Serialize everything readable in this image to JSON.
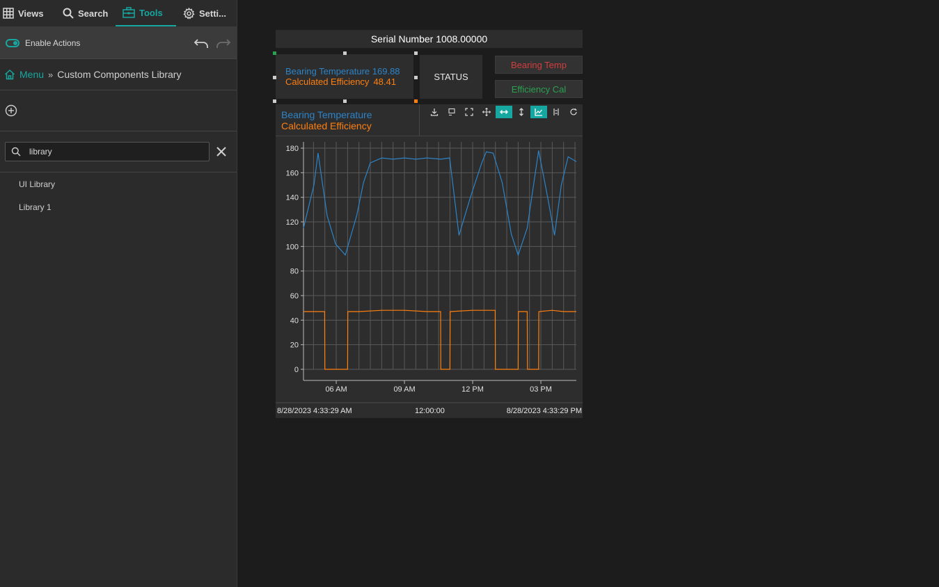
{
  "sidebar": {
    "tabs": [
      {
        "label": "Views",
        "icon": "grid-icon"
      },
      {
        "label": "Search",
        "icon": "search-icon"
      },
      {
        "label": "Tools",
        "icon": "toolbox-icon"
      },
      {
        "label": "Setti...",
        "icon": "gear-icon"
      }
    ],
    "enable_actions_label": "Enable Actions",
    "breadcrumb": {
      "menu": "Menu",
      "current": "Custom Components Library"
    },
    "search": {
      "value": "library"
    },
    "libraries": [
      "UI Library",
      "Library 1"
    ]
  },
  "widget": {
    "serial": "Serial Number 1008.00000",
    "value1": "Bearing Temperature 169.88",
    "value2_label": "Calculated Efficiency",
    "value2_value": "48.41",
    "status": "STATUS",
    "button_red": "Bearing Temp",
    "button_green": "Efficiency Cal",
    "legend": [
      "Bearing Temperature",
      "Calculated Efficiency"
    ],
    "footer": {
      "start": "8/28/2023 4:33:29 AM",
      "span": "12:00:00",
      "end": "8/28/2023 4:33:29 PM"
    },
    "colors": {
      "series1": "#2d84c8",
      "series2": "#ff7f0e",
      "accent": "#16a8a0",
      "red": "#d43d3d",
      "green": "#2aa151"
    }
  },
  "chart_data": {
    "type": "line",
    "x_tick_labels": [
      "06 AM",
      "09 AM",
      "12 PM",
      "03 PM"
    ],
    "y_ticks": [
      0,
      20,
      40,
      60,
      80,
      100,
      120,
      140,
      160,
      180
    ],
    "ylim": [
      0,
      180
    ],
    "xlim_hours": [
      4.56,
      16.56
    ],
    "series": [
      {
        "name": "Bearing Temperature",
        "x": [
          4.56,
          5.02,
          5.2,
          5.6,
          5.97,
          6.4,
          6.9,
          7.2,
          7.5,
          8.0,
          8.5,
          9.0,
          9.5,
          10.0,
          10.6,
          10.99,
          11.4,
          11.9,
          12.4,
          12.6,
          12.9,
          13.3,
          13.7,
          14.0,
          14.4,
          14.9,
          15.3,
          15.6,
          15.9,
          16.2,
          16.56
        ],
        "y": [
          115,
          150,
          176,
          125,
          102,
          93,
          125,
          152,
          168,
          172,
          171,
          172,
          171,
          172,
          171,
          172,
          109,
          140,
          168,
          177,
          176,
          152,
          110,
          93,
          115,
          178,
          140,
          109,
          150,
          173,
          169
        ]
      },
      {
        "name": "Calculated Efficiency",
        "x": [
          4.56,
          5.49,
          5.5,
          6.5,
          6.51,
          7.0,
          8.0,
          9.0,
          10.0,
          10.59,
          10.6,
          11.0,
          11.01,
          12.0,
          12.99,
          13.0,
          14.0,
          14.01,
          14.4,
          14.41,
          14.9,
          14.91,
          15.5,
          16.0,
          16.56
        ],
        "y": [
          47,
          47,
          0,
          0,
          47,
          47,
          48,
          48,
          47,
          47,
          0,
          0,
          47,
          48,
          48,
          0,
          0,
          47,
          47,
          0,
          0,
          47,
          48,
          47,
          47
        ]
      }
    ]
  }
}
